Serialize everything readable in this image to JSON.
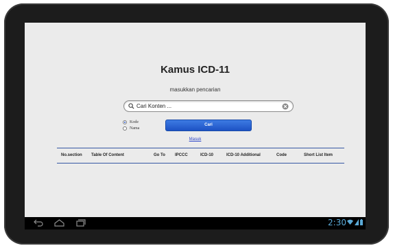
{
  "device": {
    "clock": "2:30"
  },
  "page": {
    "title": "Kamus ICD-11",
    "subtitle": "masukkan pencarian"
  },
  "search": {
    "placeholder": "Cari Konten ..."
  },
  "options": {
    "kode_label": "Kode",
    "nama_label": "Nama",
    "selected": "Kode"
  },
  "actions": {
    "cari_label": "Cari",
    "masuk_label": "Masuk"
  },
  "table": {
    "columns": [
      "No.section",
      "Table Of Content",
      "Go To",
      "IPCCC",
      "ICD-10",
      "ICD-10 Additional",
      "Code",
      "Short List Item"
    ],
    "rows": []
  },
  "colors": {
    "accent": "#1d52c4",
    "link": "#2a45c9",
    "table_border": "#3556a3",
    "clock": "#5aa9d6"
  }
}
